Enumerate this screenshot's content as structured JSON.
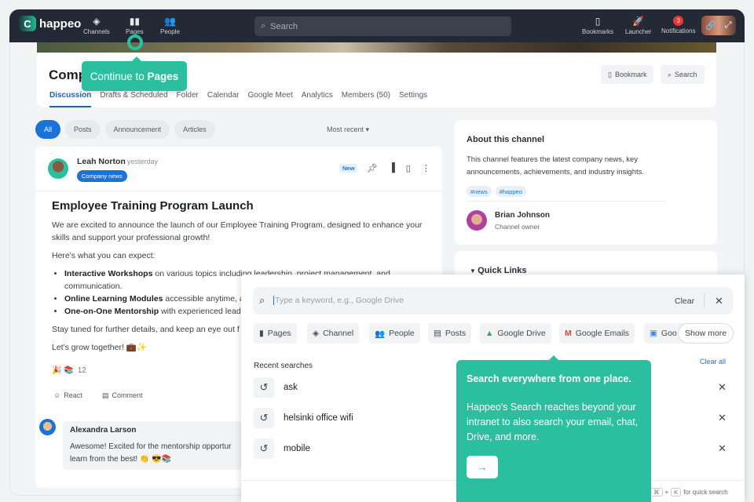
{
  "nav": {
    "logo": "happeo",
    "items": [
      "Channels",
      "Pages",
      "People"
    ],
    "search_placeholder": "Search",
    "right": [
      "Bookmarks",
      "Launcher",
      "Notifications"
    ],
    "notification_count": "3"
  },
  "header": {
    "title": "Comp",
    "tabs": [
      "Discussion",
      "Drafts & Scheduled",
      "Folder",
      "Calendar",
      "Google Meet",
      "Analytics",
      "Members (50)",
      "Settings"
    ],
    "bookmark": "Bookmark",
    "search": "Search"
  },
  "onboarding": {
    "pages_tip_prefix": "Continue to ",
    "pages_tip_bold": "Pages",
    "search_tip_title": "Search everywhere from one place.",
    "search_tip_body": "Happeo's Search reaches beyond your intranet to also search your email, chat, Drive, and more.",
    "next": "→"
  },
  "filters": {
    "chips": [
      "All",
      "Posts",
      "Announcement",
      "Articles"
    ],
    "sort": "Most recent"
  },
  "post": {
    "author": "Leah Norton",
    "time": "yesterday",
    "channel": "Company news",
    "badge": "New",
    "title": "Employee Training Program Launch",
    "intro": "We are excited to announce the launch of our Employee Training Program, designed to enhance your skills and support your professional growth!",
    "expect": "Here's what you can expect:",
    "bullets": [
      {
        "bold": "Interactive Workshops",
        "text": " on various topics including leadership, project management, and communication."
      },
      {
        "bold": "Online Learning Modules",
        "text": " accessible anytime, ar"
      },
      {
        "bold": "One-on-One Mentorship",
        "text": " with experienced leade"
      }
    ],
    "stay": "Stay tuned for further details, and keep an eye out f",
    "closing": "Let's grow together! 💼✨",
    "reactions": "🎉 📚",
    "reaction_count": "12",
    "react": "React",
    "comment": "Comment"
  },
  "comment": {
    "author": "Alexandra Larson",
    "text1": "Awesome! Excited for the mentorship opportur",
    "text2": "learn from the best! 👏 😎📚"
  },
  "about": {
    "title": "About this channel",
    "desc": "This channel features the latest company news, key announcements, achievements, and industry insights.",
    "tags": [
      "#news",
      "#happeo"
    ],
    "owner": "Brian Johnson",
    "owner_role": "Channel owner"
  },
  "quick_links": "Quick Links",
  "search_panel": {
    "placeholder": "Type a keyword, e.g., Google Drive",
    "clear": "Clear",
    "filters": [
      "Pages",
      "Channel",
      "People",
      "Posts",
      "Google Drive",
      "Google Emails",
      "Goo"
    ],
    "show_more": "Show more",
    "recent_title": "Recent searches",
    "clear_all": "Clear all",
    "recent": [
      "ask",
      "helsinki office wifi",
      "mobile"
    ],
    "hint_keys": [
      "⌘",
      "+",
      "K"
    ],
    "hint": "for quick search"
  }
}
